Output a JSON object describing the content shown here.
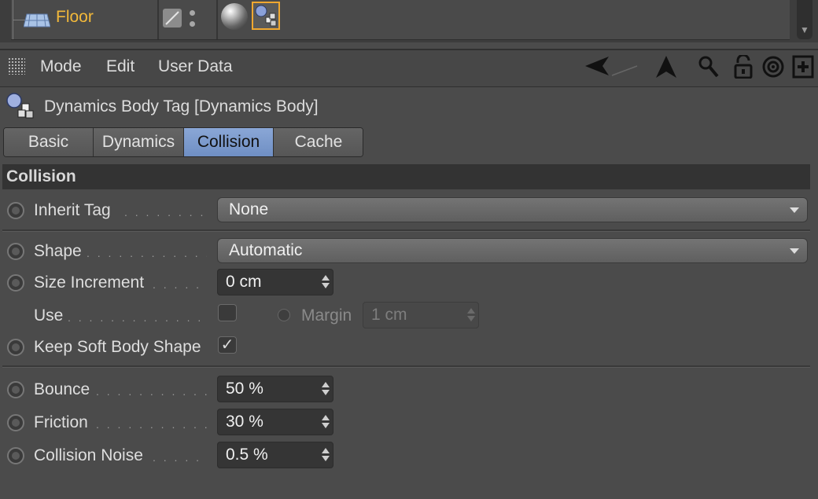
{
  "object_manager": {
    "object_name": "Floor"
  },
  "menu": {
    "items": [
      "Mode",
      "Edit",
      "User Data"
    ]
  },
  "toolbar_icons": [
    "arrow-back-icon",
    "arrow-up-icon",
    "search-icon",
    "lock-icon",
    "target-icon",
    "new-panel-icon"
  ],
  "tag": {
    "title": "Dynamics Body Tag [Dynamics Body]"
  },
  "tabs": [
    {
      "label": "Basic",
      "active": false
    },
    {
      "label": "Dynamics",
      "active": false
    },
    {
      "label": "Collision",
      "active": true
    },
    {
      "label": "Cache",
      "active": false
    }
  ],
  "section": {
    "title": "Collision"
  },
  "params": {
    "inherit_tag": {
      "label": "Inherit Tag",
      "value": "None"
    },
    "shape": {
      "label": "Shape",
      "value": "Automatic"
    },
    "size_increment": {
      "label": "Size Increment",
      "value": "0 cm"
    },
    "use": {
      "label": "Use",
      "checked": false
    },
    "margin": {
      "label": "Margin",
      "value": "1 cm"
    },
    "keep_soft_body_shape": {
      "label": "Keep Soft Body Shape",
      "checked": true,
      "mark": "✓"
    },
    "bounce": {
      "label": "Bounce",
      "value": "50 %"
    },
    "friction": {
      "label": "Friction",
      "value": "30 %"
    },
    "collision_noise": {
      "label": "Collision Noise",
      "value": "0.5 %"
    }
  },
  "colors": {
    "accent_selected_tab": "#7f9dd0",
    "object_name": "#f3b93a",
    "selection_border": "#f0a830"
  }
}
